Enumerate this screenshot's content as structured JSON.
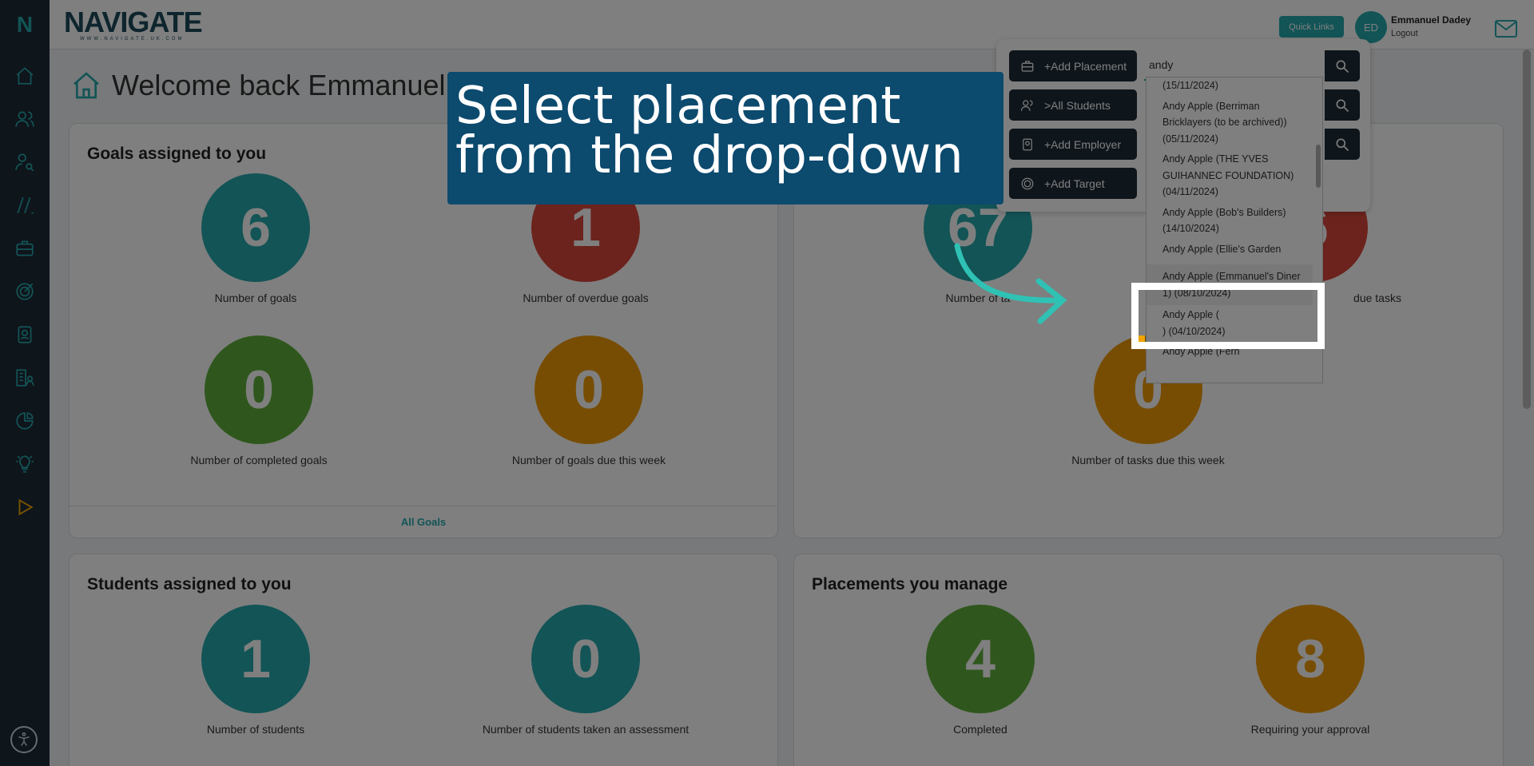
{
  "app": {
    "logo_letter": "N",
    "brand": "NAVIGATE",
    "brand_url": "WWW.NAVIGATE.UK.COM"
  },
  "header": {
    "quick_links": "Quick Links",
    "avatar_initials": "ED",
    "user_name": "Emmanuel Dadey",
    "logout": "Logout"
  },
  "welcome": "Welcome back Emmanuel",
  "goals": {
    "title": "Goals assigned to you",
    "stats": [
      {
        "value": "6",
        "label": "Number of goals",
        "color": "#26a9ad"
      },
      {
        "value": "1",
        "label": "Number of overdue goals",
        "color": "#d9473a"
      },
      {
        "value": "0",
        "label": "Number of completed goals",
        "color": "#5fae3a"
      },
      {
        "value": "0",
        "label": "Number of goals due this week",
        "color": "#ee9b06"
      }
    ],
    "footer_link": "All Goals"
  },
  "tasks": {
    "stats": [
      {
        "value": "67",
        "label": "Number of ta"
      },
      {
        "value": "6",
        "label": "due tasks"
      },
      {
        "value": "0",
        "label": "Number of tasks due this week"
      }
    ]
  },
  "students": {
    "title": "Students assigned to you",
    "stats": [
      {
        "value": "1",
        "label": "Number of students"
      },
      {
        "value": "0",
        "label": "Number of students taken an assessment"
      }
    ]
  },
  "placements": {
    "title": "Placements you manage",
    "stats": [
      {
        "value": "4",
        "label": "Completed"
      },
      {
        "value": "8",
        "label": "Requiring your approval"
      }
    ]
  },
  "quick_panel": {
    "buttons": [
      "+Add Placement",
      ">All Students",
      "+Add Employer",
      "+Add Target"
    ],
    "search_value": "andy"
  },
  "dropdown": {
    "items": [
      "(15/11/2024)",
      "Andy Apple (Berriman Bricklayers (to be archived)) (05/11/2024)",
      "Andy Apple (THE YVES GUIHANNEC FOUNDATION) (04/11/2024)",
      "Andy Apple (Bob's Builders) (14/10/2024)",
      "Andy Apple (Ellie's Garden",
      "Andy Apple (Emmanuel's Diner 1) (08/10/2024)",
      "Andy Apple (",
      ") (04/10/2024)",
      "Andy Apple (Fern"
    ]
  },
  "callout": {
    "line1": "Select placement",
    "line2": "from the drop-down"
  }
}
